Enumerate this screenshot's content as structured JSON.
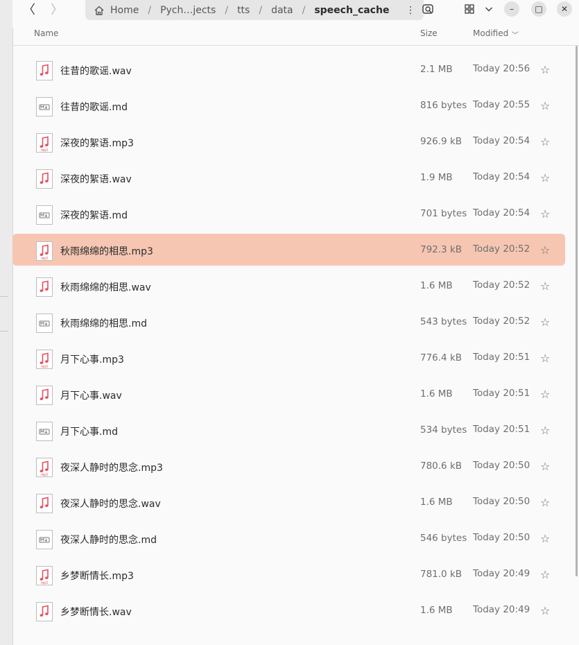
{
  "nav": {
    "back_glyph": "〈",
    "forward_glyph": "〉"
  },
  "pathbar": {
    "crumbs": [
      "Home",
      "Pych…jects",
      "tts",
      "data",
      "speech_cache"
    ],
    "separator": "/",
    "menu_glyph": "⋮"
  },
  "window": {
    "minimize_glyph": "–",
    "maximize_glyph": "□",
    "close_glyph": "✕"
  },
  "columns": {
    "name": "Name",
    "size": "Size",
    "modified": "Modified",
    "sort_glyph": "﹀"
  },
  "files": [
    {
      "name": "往昔的歌谣.wav",
      "size": "2.1 MB",
      "modified": "Today 20:56",
      "type": "wav"
    },
    {
      "name": "往昔的歌谣.md",
      "size": "816 bytes",
      "modified": "Today 20:55",
      "type": "md"
    },
    {
      "name": "深夜的絮语.mp3",
      "size": "926.9 kB",
      "modified": "Today 20:54",
      "type": "mp3"
    },
    {
      "name": "深夜的絮语.wav",
      "size": "1.9 MB",
      "modified": "Today 20:54",
      "type": "wav"
    },
    {
      "name": "深夜的絮语.md",
      "size": "701 bytes",
      "modified": "Today 20:54",
      "type": "md"
    },
    {
      "name": "秋雨绵绵的相思.mp3",
      "size": "792.3 kB",
      "modified": "Today 20:52",
      "type": "mp3",
      "selected": true
    },
    {
      "name": "秋雨绵绵的相思.wav",
      "size": "1.6 MB",
      "modified": "Today 20:52",
      "type": "wav"
    },
    {
      "name": "秋雨绵绵的相思.md",
      "size": "543 bytes",
      "modified": "Today 20:52",
      "type": "md"
    },
    {
      "name": "月下心事.mp3",
      "size": "776.4 kB",
      "modified": "Today 20:51",
      "type": "mp3"
    },
    {
      "name": "月下心事.wav",
      "size": "1.6 MB",
      "modified": "Today 20:51",
      "type": "wav"
    },
    {
      "name": "月下心事.md",
      "size": "534 bytes",
      "modified": "Today 20:51",
      "type": "md"
    },
    {
      "name": "夜深人静时的思念.mp3",
      "size": "780.6 kB",
      "modified": "Today 20:50",
      "type": "mp3"
    },
    {
      "name": "夜深人静时的思念.wav",
      "size": "1.6 MB",
      "modified": "Today 20:50",
      "type": "wav"
    },
    {
      "name": "夜深人静时的思念.md",
      "size": "546 bytes",
      "modified": "Today 20:50",
      "type": "md"
    },
    {
      "name": "乡梦断情长.mp3",
      "size": "781.0 kB",
      "modified": "Today 20:49",
      "type": "mp3"
    },
    {
      "name": "乡梦断情长.wav",
      "size": "1.6 MB",
      "modified": "Today 20:49",
      "type": "wav"
    }
  ],
  "star_glyph": "☆",
  "colors": {
    "selection": "#f6c6b3",
    "audio_note": "#e5505e",
    "md_icon": "#7a7a7a"
  }
}
